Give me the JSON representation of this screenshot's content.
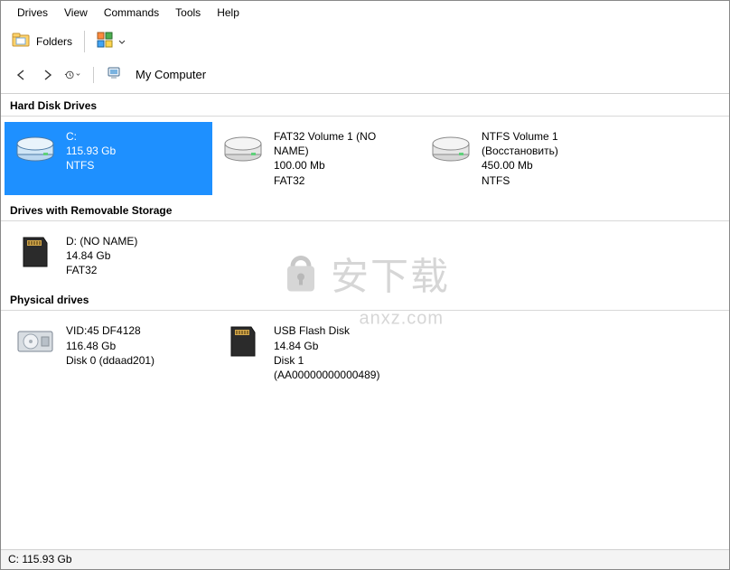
{
  "menu": {
    "items": [
      "Drives",
      "View",
      "Commands",
      "Tools",
      "Help"
    ]
  },
  "toolbar": {
    "folders_label": "Folders"
  },
  "nav": {
    "location_label": "My Computer"
  },
  "sections": {
    "hard_disk": {
      "title": "Hard Disk Drives",
      "items": [
        {
          "line1": "C:",
          "line2": "115.93 Gb",
          "line3": "NTFS",
          "icon": "hdd",
          "selected": true
        },
        {
          "line1": "FAT32 Volume 1 (NO NAME)",
          "line2": "100.00 Mb",
          "line3": "FAT32",
          "icon": "hdd",
          "selected": false
        },
        {
          "line1": "NTFS Volume 1 (Восстановить)",
          "line2": "450.00 Mb",
          "line3": "NTFS",
          "icon": "hdd",
          "selected": false
        }
      ]
    },
    "removable": {
      "title": "Drives with Removable Storage",
      "items": [
        {
          "line1": "D: (NO NAME)",
          "line2": "14.84 Gb",
          "line3": "FAT32",
          "icon": "sd"
        }
      ]
    },
    "physical": {
      "title": "Physical drives",
      "items": [
        {
          "line1": "VID:45 DF4128",
          "line2": "116.48 Gb",
          "line3": "Disk 0 (ddaad201)",
          "icon": "disk"
        },
        {
          "line1": "USB Flash Disk",
          "line2": "14.84 Gb",
          "line3": "Disk 1 (AA00000000000489)",
          "icon": "sd"
        }
      ]
    }
  },
  "status": {
    "text": "C: 115.93 Gb"
  },
  "watermark": {
    "main": "安下载",
    "sub": "anxz.com"
  }
}
